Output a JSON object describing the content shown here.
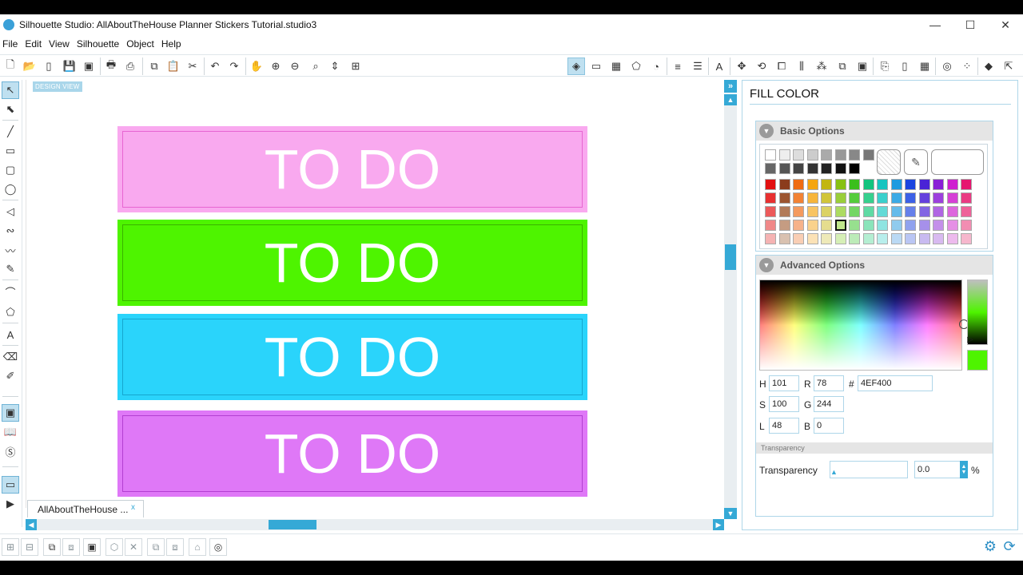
{
  "window": {
    "title": "Silhouette Studio: AllAboutTheHouse Planner Stickers Tutorial.studio3",
    "minimize": "—",
    "maximize": "☐",
    "close": "✕"
  },
  "menu": [
    "File",
    "Edit",
    "View",
    "Silhouette",
    "Object",
    "Help"
  ],
  "canvas": {
    "design_view_label": "DESIGN VIEW",
    "stickers": [
      {
        "text": "TO DO",
        "fill": "#f9a9ef",
        "stroke": "#e766d2"
      },
      {
        "text": "TO DO",
        "fill": "#4ef400",
        "stroke": "#39b400"
      },
      {
        "text": "TO DO",
        "fill": "#2ad4fb",
        "stroke": "#16a6cf"
      },
      {
        "text": "TO DO",
        "fill": "#df78f7",
        "stroke": "#b33fd2"
      }
    ]
  },
  "document_tab": {
    "label": "AllAboutTheHouse ...",
    "close": "x"
  },
  "fill_panel": {
    "title": "FILL COLOR",
    "basic_options": "Basic Options",
    "advanced_options": "Advanced Options",
    "hsl": {
      "h_label": "H",
      "h": "101",
      "s_label": "S",
      "s": "100",
      "l_label": "L",
      "l": "48"
    },
    "rgb": {
      "r_label": "R",
      "r": "78",
      "g_label": "G",
      "g": "244",
      "b_label": "B",
      "b": "0"
    },
    "hex_label": "#",
    "hex": "4EF400",
    "transparency_section": "Transparency",
    "transparency_label": "Transparency",
    "transparency_value": "0.0",
    "percent": "%",
    "selected_color": "#4ef400",
    "swatch_rows": [
      [
        "#ffffff",
        "#eeeeee",
        "#dddddd",
        "#cccccc",
        "#aaaaaa",
        "#999999",
        "#888888",
        "#777777"
      ],
      [
        "#666666",
        "#555555",
        "#444444",
        "#333333",
        "#222222",
        "#111111",
        "#000000"
      ],
      [
        "#e21010",
        "#8b3c1c",
        "#ef6c12",
        "#f5a50f",
        "#c2b611",
        "#87c112",
        "#3bbf1c",
        "#12c47e",
        "#17c4c0",
        "#1d9be0",
        "#1a45e0",
        "#4a23d6",
        "#8a1fd6",
        "#cf1fd0",
        "#e6166f"
      ],
      [
        "#e83030",
        "#9c5530",
        "#f28234",
        "#f7b53a",
        "#d1c53a",
        "#9ace3a",
        "#55cc3c",
        "#36d08e",
        "#3ad0cc",
        "#3caae6",
        "#3c60e6",
        "#6440dd",
        "#9c40dd",
        "#d640d6",
        "#ea3b83"
      ],
      [
        "#ec5a5a",
        "#b27a58",
        "#f49a5e",
        "#f8c463",
        "#dbd264",
        "#addb62",
        "#74d664",
        "#60daa4",
        "#64dad6",
        "#66bbea",
        "#6680ea",
        "#8266e3",
        "#b066e3",
        "#dd66dd",
        "#ee6299"
      ],
      [
        "#f08888",
        "#c59c82",
        "#f6b28a",
        "#fad28c",
        "#e5dd8e",
        "#c0e68c",
        "#97e08e",
        "#8ae4ba",
        "#8ee4e1",
        "#90cbee",
        "#90a2ee",
        "#a690ea",
        "#c490ea",
        "#e590e5",
        "#f28db2"
      ],
      [
        "#f5b3b3",
        "#d9c1b0",
        "#f9ceb4",
        "#fce2b6",
        "#eee9b8",
        "#d6efb6",
        "#bcebb8",
        "#b4eed2",
        "#b8eeec",
        "#bad9f4",
        "#bac6f4",
        "#c8baf0",
        "#d8baf0",
        "#edbaed",
        "#f6b7cd"
      ]
    ]
  }
}
